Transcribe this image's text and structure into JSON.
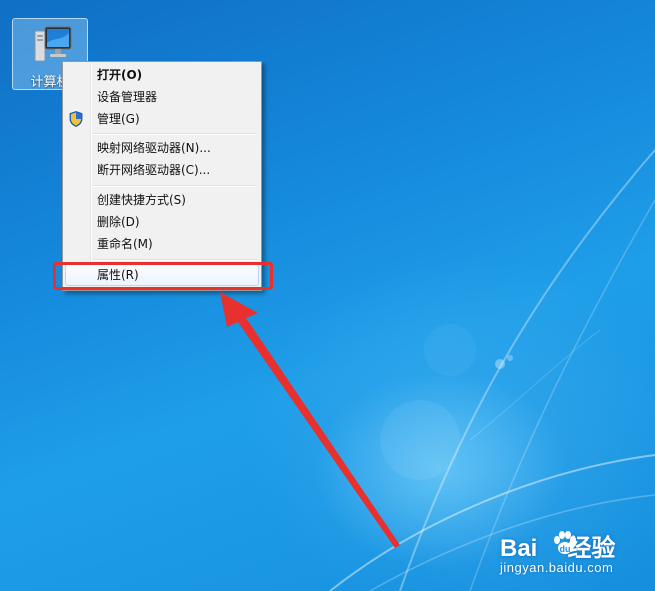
{
  "desktop": {
    "icon_label": "计算机"
  },
  "context_menu": {
    "items": [
      {
        "label": "打开(O)",
        "bold": true
      },
      {
        "label": "设备管理器"
      },
      {
        "label": "管理(G)",
        "icon": "uac-shield-icon"
      },
      {
        "label": "映射网络驱动器(N)..."
      },
      {
        "label": "断开网络驱动器(C)..."
      },
      {
        "label": "创建快捷方式(S)"
      },
      {
        "label": "删除(D)"
      },
      {
        "label": "重命名(M)"
      },
      {
        "label": "属性(R)",
        "highlighted": true
      }
    ]
  },
  "annotation": {
    "color": "#e8302f",
    "target": "属性(R)"
  },
  "watermark": {
    "brand_left": "Bai",
    "brand_right": "经验",
    "url": "jingyan.baidu.com"
  }
}
